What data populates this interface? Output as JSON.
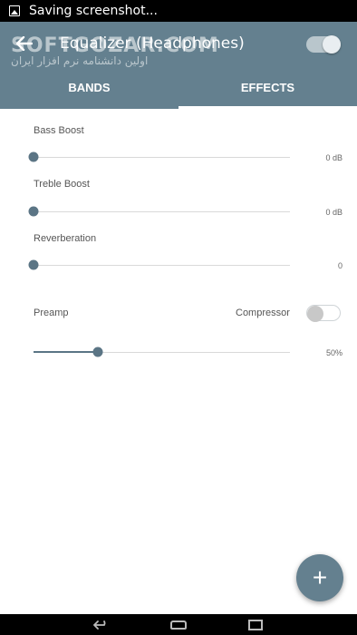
{
  "status_bar": {
    "text": "Saving screenshot..."
  },
  "app_bar": {
    "title": "Equalizer (Headphones)",
    "watermark": "SOFTGOZAR.COM",
    "watermark_sub": "اولین دانشنامه نرم افزار ایران",
    "enabled": true
  },
  "tabs": [
    {
      "label": "BANDS",
      "active": false
    },
    {
      "label": "EFFECTS",
      "active": true
    }
  ],
  "effects": {
    "bass_boost": {
      "label": "Bass Boost",
      "value_text": "0 dB",
      "level": 0
    },
    "treble_boost": {
      "label": "Treble Boost",
      "value_text": "0 dB",
      "level": 0
    },
    "reverberation": {
      "label": "Reverberation",
      "value_text": "0",
      "level": 0
    },
    "preamp": {
      "label": "Preamp",
      "value_text": "50%",
      "level": 0.25
    },
    "compressor": {
      "label": "Compressor",
      "enabled": false
    }
  },
  "fab": {
    "icon": "plus-icon",
    "glyph": "+"
  },
  "nav": {
    "back_icon": "nav-back-icon",
    "home_icon": "nav-home-icon",
    "recents_icon": "nav-recents-icon"
  },
  "colors": {
    "primary": "#64808f",
    "accent": "#5b7585"
  }
}
